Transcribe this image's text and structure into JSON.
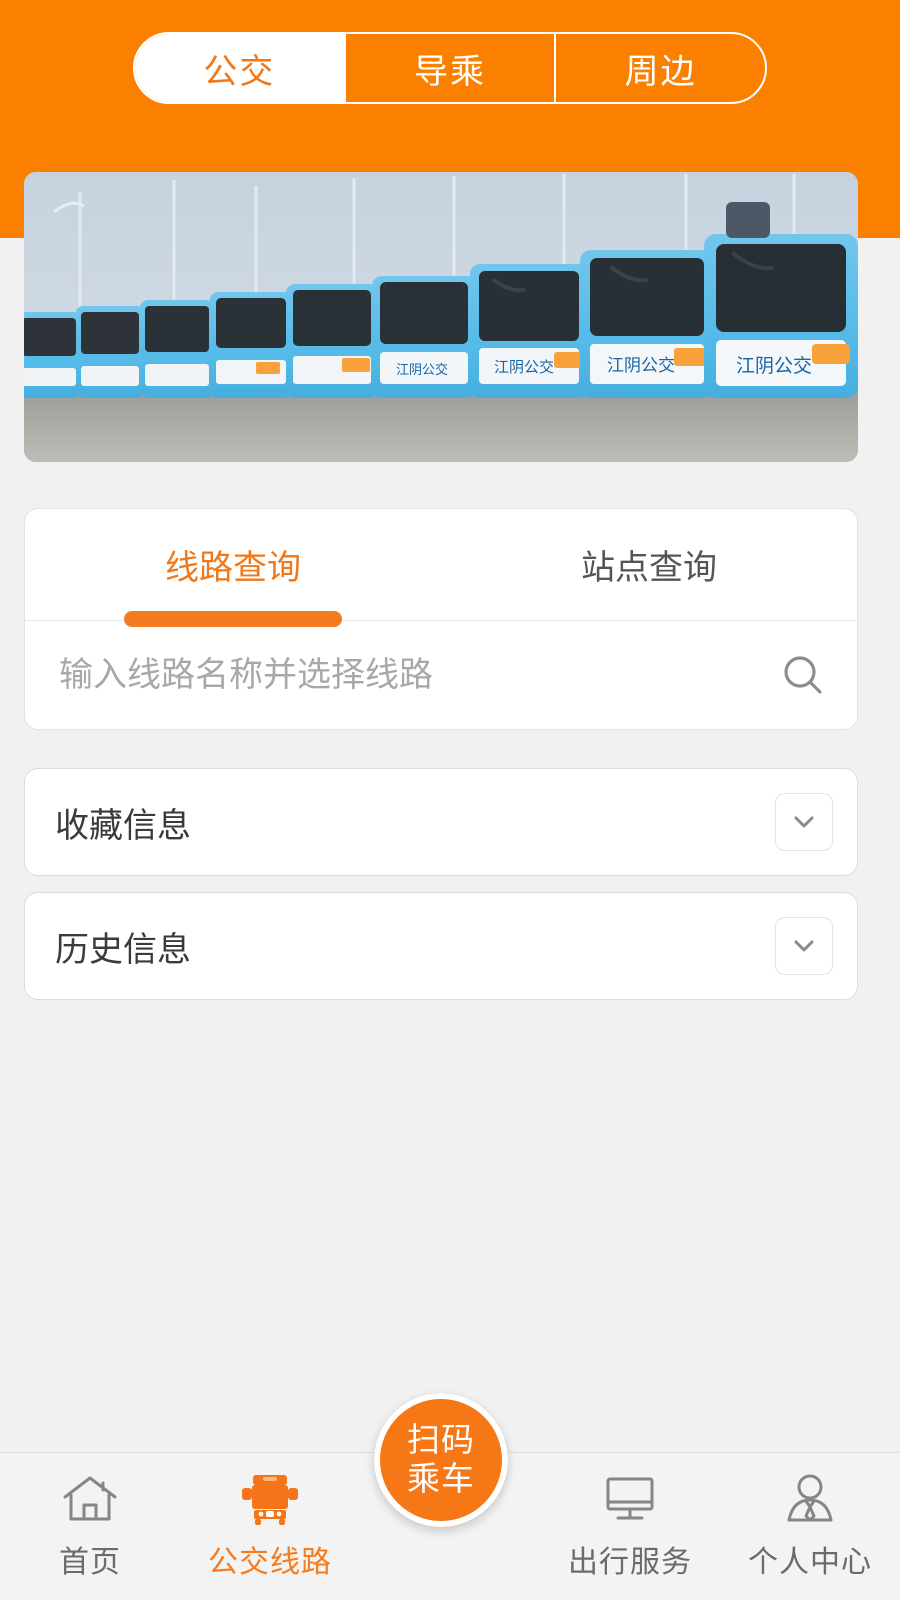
{
  "theme": {
    "brand_orange": "#fb8000",
    "accent_orange": "#f47c20",
    "page_background": "#f1f1f1",
    "card_background": "#ffffff",
    "muted_text": "#6b6b6b"
  },
  "header": {
    "segments": [
      {
        "label": "公交",
        "active": true
      },
      {
        "label": "导乘",
        "active": false
      },
      {
        "label": "周边",
        "active": false
      }
    ]
  },
  "banner": {
    "alt": "江阴公交 bus fleet lineup",
    "bus_livery_text": "江阴公交"
  },
  "query_card": {
    "tabs": [
      {
        "label": "线路查询",
        "active": true
      },
      {
        "label": "站点查询",
        "active": false
      }
    ],
    "search": {
      "value": "",
      "placeholder": "输入线路名称并选择线路",
      "icon": "search-icon"
    }
  },
  "accordions": [
    {
      "label": "收藏信息",
      "toggle_icon": "chevron-down-icon",
      "expanded": false
    },
    {
      "label": "历史信息",
      "toggle_icon": "chevron-down-icon",
      "expanded": false
    }
  ],
  "fab": {
    "line1": "扫码",
    "line2": "乘车",
    "icon": "scan-qr-ride-button"
  },
  "bottom_nav": [
    {
      "label": "首页",
      "icon": "home-icon",
      "active": false
    },
    {
      "label": "公交线路",
      "icon": "bus-icon",
      "active": true
    },
    {
      "label": "出行服务",
      "icon": "monitor-icon",
      "active": false
    },
    {
      "label": "个人中心",
      "icon": "user-icon",
      "active": false
    }
  ]
}
